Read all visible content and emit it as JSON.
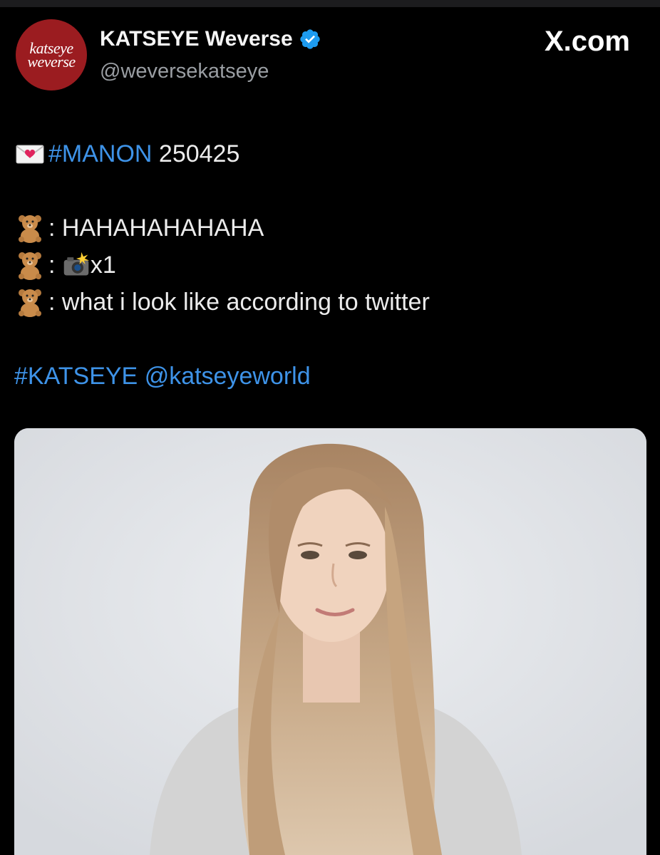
{
  "account": {
    "avatar_line1": "katseye",
    "avatar_line2": "weverse",
    "display_name": "KATSEYE Weverse",
    "handle": "@weversekatseye",
    "verified": true
  },
  "watermark": "X.com",
  "tweet": {
    "line1": {
      "emoji": "love-letter",
      "hashtag": "#MANON",
      "text": " 250425"
    },
    "bear_lines": [
      {
        "emoji": "teddy-bear",
        "text": ": HAHAHAHAHAHA"
      },
      {
        "emoji": "teddy-bear",
        "prefix": ": ",
        "inline_emoji": "camera-with-flash",
        "text": "x1"
      },
      {
        "emoji": "teddy-bear",
        "text": ": what i look like according to twitter"
      }
    ],
    "footer": {
      "hashtag": "#KATSEYE",
      "mention": "@katseyeworld"
    }
  },
  "colors": {
    "background": "#000000",
    "link": "#3e93e8",
    "verified": "#1d9bf0",
    "avatar": "#9b1c20"
  }
}
